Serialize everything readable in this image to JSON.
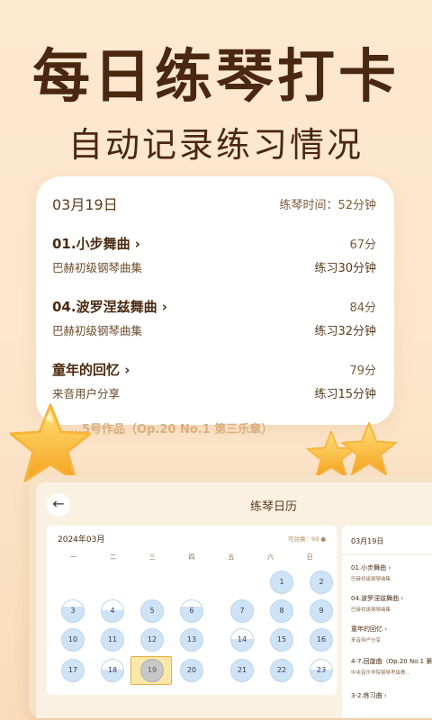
{
  "hero": {
    "title": "每日练琴打卡",
    "subtitle": "自动记录练习情况"
  },
  "card": {
    "date": "03月19日",
    "practice_time": "练琴时间：52分钟",
    "pieces": [
      {
        "name": "01.小步舞曲 ›",
        "score": "67分",
        "book": "巴赫初级钢琴曲集",
        "duration": "练习30分钟"
      },
      {
        "name": "04.波罗涅兹舞曲 ›",
        "score": "84分",
        "book": "巴赫初级钢琴曲集",
        "duration": "练习32分钟"
      },
      {
        "name": "童年的回忆 ›",
        "score": "79分",
        "book": "来音用户分享",
        "duration": "练习15分钟"
      }
    ],
    "peek_text": "…5号作品（Op.20 No.1 第三乐章）"
  },
  "tablet": {
    "back_glyph": "←",
    "title": "练琴日历",
    "calendar": {
      "month": "2024年03月",
      "credit": "可兑换：99 ●",
      "weekdays": [
        "一",
        "二",
        "三",
        "四",
        "五",
        "六",
        "日"
      ],
      "days": [
        "1",
        "2",
        "3",
        "4",
        "5",
        "6",
        "7",
        "8",
        "9",
        "10",
        "11",
        "12",
        "13",
        "14",
        "15",
        "16",
        "17",
        "18",
        "19",
        "20",
        "21",
        "22",
        "23"
      ],
      "selected_day": "19"
    },
    "side": {
      "date": "03月19日",
      "items": [
        {
          "name": "01.小步舞曲 ›",
          "book": "巴赫初级钢琴曲集"
        },
        {
          "name": "04.波罗涅兹舞曲 ›",
          "book": "巴赫初级钢琴曲集"
        },
        {
          "name": "童年的回忆 ›",
          "book": "来音用户分享"
        },
        {
          "name": "4-7.回旋曲（Op.20 No.1 第...",
          "book": "中央音乐学院钢琴考级教..."
        },
        {
          "name": "3-2.练习曲 ›",
          "book": ""
        }
      ]
    }
  },
  "colors": {
    "background": "#fde9d0",
    "title": "#4a2710",
    "day_fill": "#cfe3f6",
    "selected_highlight": "#fbe7a8"
  }
}
